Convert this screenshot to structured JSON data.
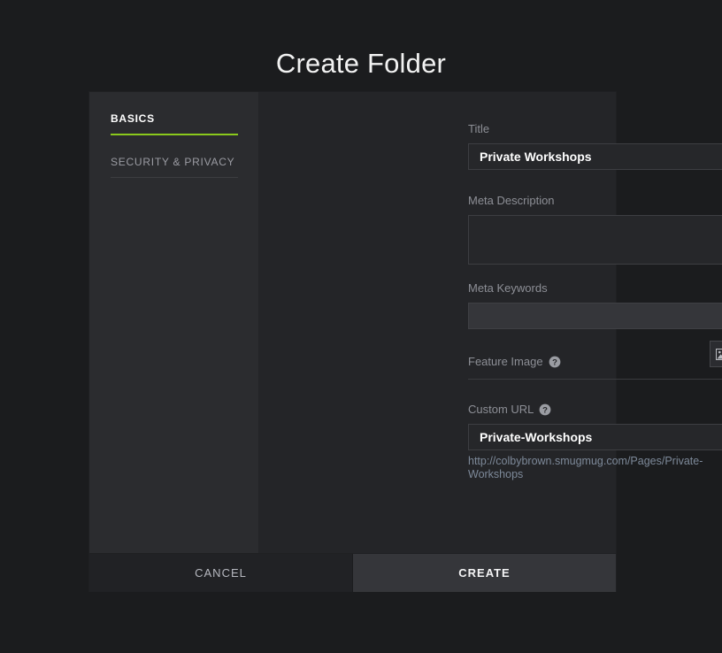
{
  "page": {
    "title": "Create Folder"
  },
  "sidebar": {
    "items": [
      {
        "label": "BASICS",
        "active": true
      },
      {
        "label": "SECURITY & PRIVACY",
        "active": false
      }
    ]
  },
  "form": {
    "title": {
      "label": "Title",
      "value": "Private Workshops",
      "placeholder": ""
    },
    "meta_description": {
      "label": "Meta Description",
      "value": "",
      "placeholder": ""
    },
    "meta_keywords": {
      "label": "Meta Keywords",
      "value": "",
      "placeholder": ""
    },
    "feature_image": {
      "label": "Feature Image",
      "help_icon": "help-circle-icon",
      "button_icon": "image-icon"
    },
    "custom_url": {
      "label": "Custom URL",
      "help_icon": "help-circle-icon",
      "value": "Private-Workshops",
      "placeholder": "",
      "preview": "http://colbybrown.smugmug.com/Pages/Private-Workshops"
    }
  },
  "footer": {
    "cancel_label": "CANCEL",
    "create_label": "CREATE"
  },
  "colors": {
    "accent_green": "#8ac91c",
    "page_background": "#1b1c1e",
    "panel_background": "#242528",
    "sidebar_background": "#2b2c2f",
    "link_preview": "#7d8999",
    "create_button": "#35363a",
    "cancel_button": "#212225"
  }
}
